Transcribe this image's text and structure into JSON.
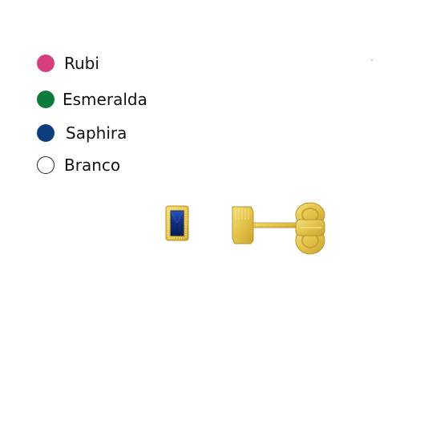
{
  "legend": {
    "items": [
      {
        "label": "Rubi",
        "color": "#d63f7d",
        "outline": false
      },
      {
        "label": "Esmeralda",
        "color": "#0b7a3b",
        "outline": false
      },
      {
        "label": "Saphira",
        "color": "#0f3c7c",
        "outline": false
      },
      {
        "label": "Branco",
        "color": "#ffffff",
        "outline": true
      }
    ]
  },
  "product": {
    "metal_color": "#e7c94f",
    "stone_color": "#163a8a",
    "icons": [
      "earring-front-view",
      "earring-side-view"
    ]
  }
}
